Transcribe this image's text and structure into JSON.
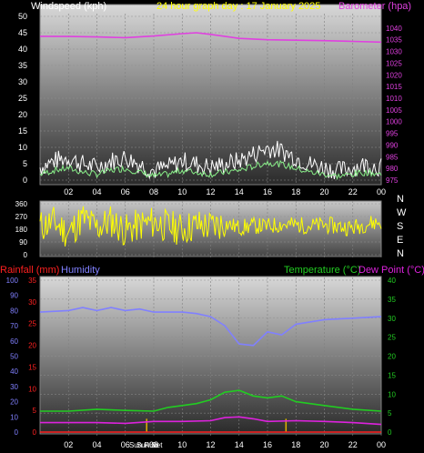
{
  "header": {
    "windspeed_label": "Windspeed (kph)",
    "title": "24 hour graph day : 17 January 2025",
    "barometer_label": "Barometer (hpa)"
  },
  "bottom_labels": {
    "rainfall_label": "Rainfall (mm)",
    "humidity_label": "Humidity",
    "temperature_label": "Temperature (°C)",
    "dewpoint_label": "Dew Point (°C)",
    "sunrise_label": "Sun Rise",
    "sunset_label": "Sun Set"
  },
  "colors": {
    "wind": "#ffffff",
    "gust": "#c0c0c0",
    "avg_wind": "#88ee88",
    "barometer": "#e040e0",
    "direction": "#ffff00",
    "humidity": "#8080ff",
    "temperature": "#22cc22",
    "dewpoint": "#dd22dd",
    "rainfall": "#ff2020",
    "sun_marker": "#e0b000",
    "title": "#ffff00",
    "label_white": "#ffffff"
  },
  "chart_data": [
    {
      "type": "line",
      "title": "24 hour graph day : 17 January 2025",
      "x_ticks": [
        "02",
        "04",
        "06",
        "08",
        "10",
        "12",
        "14",
        "16",
        "18",
        "20",
        "22",
        "00"
      ],
      "x_range_hours": [
        0,
        24
      ],
      "ylabel": "Windspeed (kph)",
      "ylim": [
        0,
        50
      ],
      "y_ticks": [
        0,
        5,
        10,
        15,
        20,
        25,
        30,
        35,
        40,
        45,
        50
      ],
      "y2label": "Barometer (hpa)",
      "y2lim": [
        975,
        1045
      ],
      "y2_ticks": [
        975,
        980,
        985,
        990,
        995,
        1000,
        1005,
        1010,
        1015,
        1020,
        1025,
        1030,
        1035,
        1040
      ],
      "series": [
        {
          "name": "Windspeed (kph)",
          "axis": "left",
          "x": [
            0,
            1,
            2,
            3,
            4,
            5,
            6,
            7,
            8,
            9,
            10,
            11,
            12,
            13,
            14,
            15,
            16,
            17,
            18,
            19,
            20,
            21,
            22,
            23,
            24
          ],
          "y": [
            3,
            5,
            6,
            4,
            3,
            5,
            6,
            4,
            2,
            3,
            5,
            4,
            3,
            4,
            5,
            7,
            9,
            8,
            6,
            4,
            3,
            2,
            3,
            4,
            3
          ]
        },
        {
          "name": "Barometer (hpa)",
          "axis": "right",
          "x": [
            0,
            2,
            4,
            6,
            8,
            10,
            11,
            12,
            14,
            16,
            18,
            20,
            22,
            24
          ],
          "y": [
            1036.5,
            1036.4,
            1036.2,
            1035.9,
            1036.6,
            1037.6,
            1038.0,
            1037.3,
            1035.6,
            1035.0,
            1034.8,
            1034.6,
            1034.3,
            1034.0
          ]
        }
      ]
    },
    {
      "type": "line",
      "ylabel": "Wind direction",
      "ylim": [
        0,
        360
      ],
      "y_ticks": [
        0,
        90,
        180,
        270,
        360
      ],
      "y_tick_labels": [
        "0",
        "90",
        "180",
        "270",
        "360"
      ],
      "right_labels": [
        "N",
        "W",
        "S",
        "E",
        "N"
      ],
      "series": [
        {
          "name": "Wind direction",
          "x": [
            0,
            1,
            2,
            3,
            4,
            5,
            6,
            7,
            8,
            9,
            10,
            11,
            12,
            13,
            14,
            15,
            16,
            17,
            18,
            19,
            20,
            21,
            22,
            23,
            24
          ],
          "y": [
            200,
            230,
            150,
            260,
            190,
            240,
            170,
            210,
            230,
            200,
            180,
            210,
            200,
            220,
            190,
            205,
            200,
            215,
            210,
            205,
            210,
            200,
            190,
            220,
            230
          ]
        }
      ]
    },
    {
      "type": "line",
      "x_ticks": [
        "02",
        "04",
        "06",
        "08",
        "10",
        "12",
        "14",
        "16",
        "18",
        "20",
        "22",
        "00"
      ],
      "x_range_hours": [
        0,
        24
      ],
      "y_left_outer_ticks": [
        0,
        10,
        20,
        30,
        40,
        50,
        60,
        70,
        80,
        90,
        100
      ],
      "y_left_inner_ticks": [
        0,
        5,
        10,
        15,
        20,
        25,
        30,
        35
      ],
      "ylim_humidity": [
        0,
        100
      ],
      "ylim_rainfall": [
        0,
        35
      ],
      "ylim_temperature": [
        0,
        40
      ],
      "y_right_ticks": [
        0,
        5,
        10,
        15,
        20,
        25,
        30,
        35,
        40
      ],
      "sunrise_hour": 7.5,
      "sunset_hour": 17.3,
      "series": [
        {
          "name": "Humidity",
          "axis": "humidity",
          "x": [
            0,
            2,
            3,
            4,
            5,
            6,
            7,
            8,
            10,
            11,
            12,
            13,
            14,
            15,
            16,
            17,
            18,
            20,
            22,
            24
          ],
          "y": [
            79,
            80,
            82,
            80,
            82,
            80,
            81,
            79,
            79,
            78,
            76,
            70,
            58,
            57,
            66,
            64,
            71,
            74,
            75,
            76
          ]
        },
        {
          "name": "Temperature (°C)",
          "axis": "temperature",
          "x": [
            0,
            2,
            4,
            6,
            8,
            9,
            10,
            11,
            12,
            13,
            14,
            15,
            16,
            17,
            18,
            20,
            22,
            24
          ],
          "y": [
            5.5,
            5.5,
            6.0,
            5.7,
            5.5,
            6.5,
            7.0,
            7.5,
            8.5,
            10.5,
            11.0,
            9.5,
            9.0,
            9.5,
            8.0,
            7.0,
            6.0,
            5.5
          ]
        },
        {
          "name": "Dew Point (°C)",
          "axis": "temperature",
          "x": [
            0,
            2,
            4,
            6,
            8,
            10,
            12,
            13,
            14,
            15,
            16,
            18,
            20,
            22,
            24
          ],
          "y": [
            2.5,
            2.5,
            2.5,
            2.3,
            2.8,
            2.8,
            3.0,
            3.8,
            4.0,
            3.5,
            2.8,
            3.0,
            2.8,
            2.5,
            2.0
          ]
        },
        {
          "name": "Rainfall (mm)",
          "axis": "rainfall",
          "x": [
            0,
            24
          ],
          "y": [
            0,
            0
          ]
        }
      ]
    }
  ]
}
